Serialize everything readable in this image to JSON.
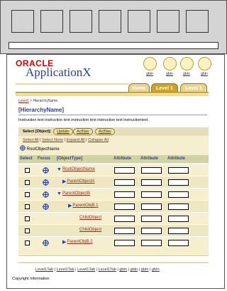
{
  "app": {
    "logo": "ORACLE",
    "name": "ApplicationX"
  },
  "global_buttons": [
    "gbtn",
    "gbtn",
    "gbtn",
    "gbtn"
  ],
  "tabs": {
    "home": "Home",
    "level1_active": "Level 1",
    "level1_inactive": "Level 1"
  },
  "breadcrumb": {
    "link": "Level1",
    "sep": " > ",
    "current": "HierarchyName"
  },
  "page": {
    "title": "[HierarchyName]",
    "instruction": "Instruction text instruction text instruction text instruction text instructiontext."
  },
  "select_bar": {
    "label": "Select [Object]:",
    "buttons": [
      "Update",
      "ActNav",
      "ActNav"
    ]
  },
  "select_links": {
    "select_all": "Select All",
    "select_none": "Select None",
    "expand_all": "Expand All",
    "collapse_all": "Collapse All",
    "sep": " | "
  },
  "root": {
    "label": "RootObjectName"
  },
  "table": {
    "headers": {
      "select": "Select",
      "focus": "Focus",
      "object_type": "[ObjectType]",
      "attr1": "Attribute",
      "attr2": "Attribute",
      "attr3": "Attribute"
    },
    "rows": [
      {
        "name": "RootObjectName",
        "expander": "down",
        "link": true
      },
      {
        "name": "ParentObjectA",
        "expander": "right",
        "link": true
      },
      {
        "name": "ParentObjectB",
        "expander": "down",
        "link": true
      },
      {
        "name": "ParentObjB.1",
        "expander": "right",
        "link": true
      },
      {
        "name": "ChildObject",
        "expander": "none",
        "link": true
      },
      {
        "name": "ChildObject",
        "expander": "none",
        "link": true
      },
      {
        "name": "ParentObjB.2",
        "expander": "right",
        "link": true
      }
    ]
  },
  "footer": {
    "links": [
      "Level1Tab",
      "Level1Tab",
      "Level1Tab",
      "Level1Tab",
      "gbtn",
      "gbtn",
      "gbtn",
      "gbtn"
    ],
    "sep": " | ",
    "copyright": "Copyright Information"
  },
  "colors": {
    "accent": "#c9a227",
    "link": "#8b2e1a",
    "title": "#2b3f8c",
    "panel": "#f5efd0",
    "header": "#d2d3a4"
  }
}
